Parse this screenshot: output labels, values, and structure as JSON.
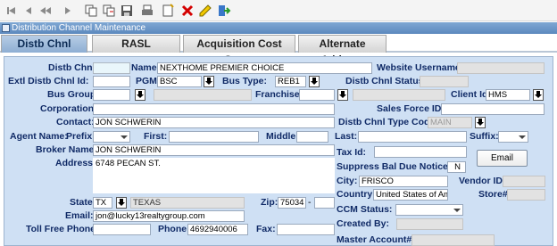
{
  "toolbar": {
    "icons": [
      "first-record-icon",
      "previous-record-icon",
      "previous-page-icon",
      "next-page-icon",
      "copy-icon",
      "copy-new-icon",
      "save-icon",
      "print-icon",
      "new-record-icon",
      "delete-icon",
      "edit-icon",
      "exit-icon"
    ]
  },
  "window": {
    "title": "Distribution Channel Maintenance"
  },
  "tabs": [
    "Distb Chnl",
    "RASL",
    "Acquisition Cost Setup",
    "Alternate Address"
  ],
  "form": {
    "distb_chnl_id_label": "Distb Chnl Id:",
    "distb_chnl_id": "",
    "name_label": "Name:",
    "name": "NEXTHOME PREMIER CHOICE",
    "website_username_label": "Website Username:",
    "website_username": "",
    "extl_id_label": "Extl Distb Chnl Id:",
    "extl_id": "",
    "pgm_label": "PGM:",
    "pgm": "BSC",
    "bus_type_label": "Bus Type:",
    "bus_type": "REB1",
    "status_label": "Distb Chnl Status:",
    "status": "",
    "bus_group_label": "Bus Group:",
    "bus_group": "",
    "franchise_label": "Franchise:",
    "franchise": "",
    "client_id_label": "Client Id:",
    "client_id": "HMS",
    "corporation_label": "Corporation:",
    "corporation": "",
    "sales_force_label": "Sales Force ID:",
    "sales_force": "",
    "contact_label": "Contact:",
    "contact": "JON SCHWERIN",
    "type_code_label": "Distb Chnl Type Code:",
    "type_code": "MAIN",
    "agent_name_label": "Agent Name:",
    "prefix_label": "Prefix:",
    "prefix": "",
    "first_label": "First:",
    "first": "",
    "middle_label": "Middle:",
    "middle": "",
    "last_label": "Last:",
    "last": "",
    "suffix_label": "Suffix:",
    "suffix": "",
    "broker_name_label": "Broker Name:",
    "broker_name": "JON SCHWERIN",
    "address_label": "Address:",
    "address": "6748 PECAN ST.",
    "tax_id_label": "Tax Id:",
    "tax_id": "",
    "suppress_label": "Suppress Bal Due Notice",
    "suppress": "N",
    "email_button": "Email",
    "city_label": "City:",
    "city": "FRISCO",
    "vendor_label": "Vendor ID#",
    "vendor": "",
    "country_label": "Country:",
    "country": "United States of Ame",
    "store_label": "Store#",
    "store": "",
    "state_label": "State:",
    "state": "TX",
    "state_name": "TEXAS",
    "zip_label": "Zip:",
    "zip": "75034",
    "zip_sep": "-",
    "zip_ext": "",
    "ccm_label": "CCM Status:",
    "ccm": "",
    "email_label": "Email:",
    "email": "jon@lucky13realtygroup.com",
    "created_by_label": "Created By:",
    "created_by": "",
    "toll_free_label": "Toll Free Phone:",
    "toll_free": "",
    "phone_label": "Phone:",
    "phone": "4692940006",
    "fax_label": "Fax:",
    "fax": "",
    "master_label": "Master Account#",
    "master": ""
  }
}
